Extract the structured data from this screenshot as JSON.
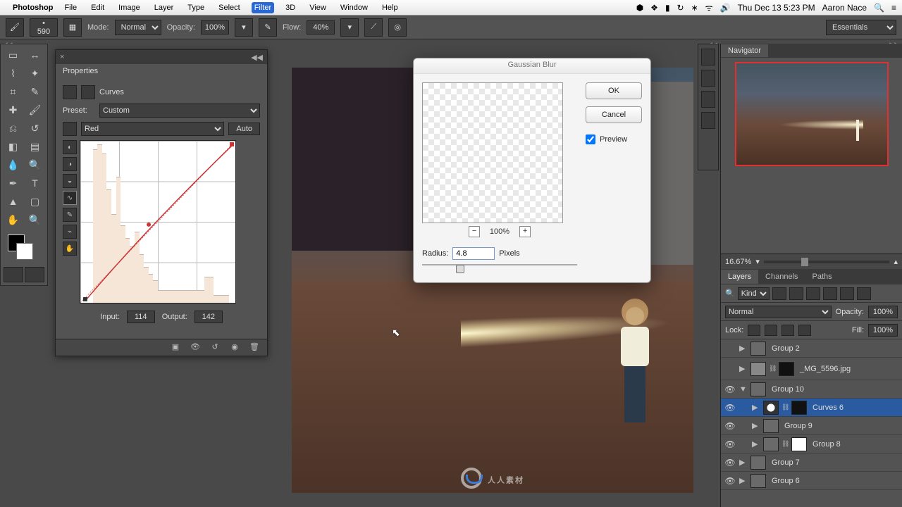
{
  "menubar": {
    "app": "Photoshop",
    "items": [
      "File",
      "Edit",
      "Image",
      "Layer",
      "Type",
      "Select",
      "Filter",
      "3D",
      "View",
      "Window",
      "Help"
    ],
    "active_index": 6,
    "datetime": "Thu Dec 13  5:23 PM",
    "user": "Aaron Nace"
  },
  "options": {
    "brush_size": "590",
    "mode_label": "Mode:",
    "mode_value": "Normal",
    "opacity_label": "Opacity:",
    "opacity_value": "100%",
    "flow_label": "Flow:",
    "flow_value": "40%",
    "workspace": "Essentials"
  },
  "properties": {
    "panel_title": "Properties",
    "adjust_type": "Curves",
    "preset_label": "Preset:",
    "preset_value": "Custom",
    "channel_value": "Red",
    "auto_label": "Auto",
    "input_label": "Input:",
    "input_value": "114",
    "output_label": "Output:",
    "output_value": "142"
  },
  "dialog": {
    "title": "Gaussian Blur",
    "ok": "OK",
    "cancel": "Cancel",
    "preview_label": "Preview",
    "preview_checked": true,
    "zoom": "100%",
    "radius_label": "Radius:",
    "radius_value": "4.8",
    "radius_unit": "Pixels"
  },
  "navigator": {
    "title": "Navigator",
    "zoom": "16.67%"
  },
  "layers": {
    "tabs": [
      "Layers",
      "Channels",
      "Paths"
    ],
    "active_tab": 0,
    "kind_label": "Kind",
    "blend_mode": "Normal",
    "opacity_label": "Opacity:",
    "opacity_value": "100%",
    "lock_label": "Lock:",
    "fill_label": "Fill:",
    "fill_value": "100%",
    "items": [
      {
        "name": "Group 2",
        "type": "group",
        "visible": false,
        "open": false,
        "indent": 0
      },
      {
        "name": "_MG_5596.jpg",
        "type": "smart",
        "visible": false,
        "open": false,
        "indent": 0,
        "masked": true
      },
      {
        "name": "Group 10",
        "type": "group",
        "visible": true,
        "open": true,
        "indent": 0
      },
      {
        "name": "Curves 6",
        "type": "adjust",
        "visible": true,
        "open": false,
        "indent": 1,
        "selected": true,
        "masked": true
      },
      {
        "name": "Group 9",
        "type": "group",
        "visible": true,
        "open": false,
        "indent": 1
      },
      {
        "name": "Group 8",
        "type": "group",
        "visible": true,
        "open": false,
        "indent": 1,
        "masked_white": true
      },
      {
        "name": "Group 7",
        "type": "group",
        "visible": true,
        "open": false,
        "indent": 0
      },
      {
        "name": "Group 6",
        "type": "group",
        "visible": true,
        "open": false,
        "indent": 0
      }
    ]
  },
  "watermark": "人人素材"
}
